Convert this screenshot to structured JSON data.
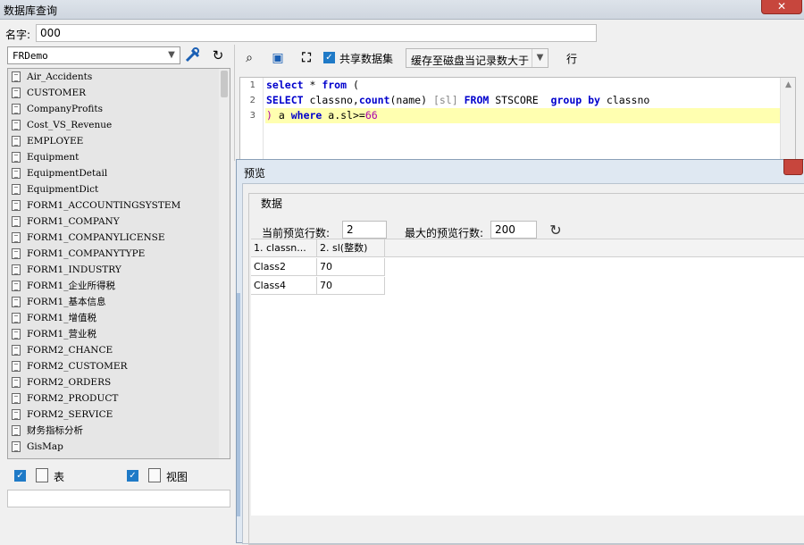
{
  "window": {
    "title": "数据库查询",
    "close_symbol": "✕"
  },
  "name_field": {
    "label": "名字:",
    "value": "000"
  },
  "left_panel": {
    "database": "FRDemo",
    "tables": [
      "Air_Accidents",
      "CUSTOMER",
      "CompanyProfits",
      "Cost_VS_Revenue",
      "EMPLOYEE",
      "Equipment",
      "EquipmentDetail",
      "EquipmentDict",
      "FORM1_ACCOUNTINGSYSTEM",
      "FORM1_COMPANY",
      "FORM1_COMPANYLICENSE",
      "FORM1_COMPANYTYPE",
      "FORM1_INDUSTRY",
      "FORM1_企业所得税",
      "FORM1_基本信息",
      "FORM1_增值税",
      "FORM1_营业税",
      "FORM2_CHANCE",
      "FORM2_CUSTOMER",
      "FORM2_ORDERS",
      "FORM2_PRODUCT",
      "FORM2_SERVICE",
      "财务指标分析",
      "GisMap"
    ],
    "filter_table_label": "表",
    "filter_view_label": "视图"
  },
  "toolbar": {
    "share_dataset_label": "共享数据集",
    "cache_option": "缓存至磁盘当记录数大于",
    "unit_label": "行"
  },
  "editor": {
    "line_numbers": [
      "1",
      "2",
      "3"
    ]
  },
  "preview": {
    "title": "预览",
    "group_title": "数据",
    "current_rows_label": "当前预览行数:",
    "current_rows_value": "2",
    "max_rows_label": "最大的预览行数:",
    "max_rows_value": "200",
    "columns": [
      "1. classn...",
      "2. sl(整数)"
    ],
    "rows": [
      [
        "Class2",
        "70"
      ],
      [
        "Class4",
        "70"
      ]
    ]
  }
}
